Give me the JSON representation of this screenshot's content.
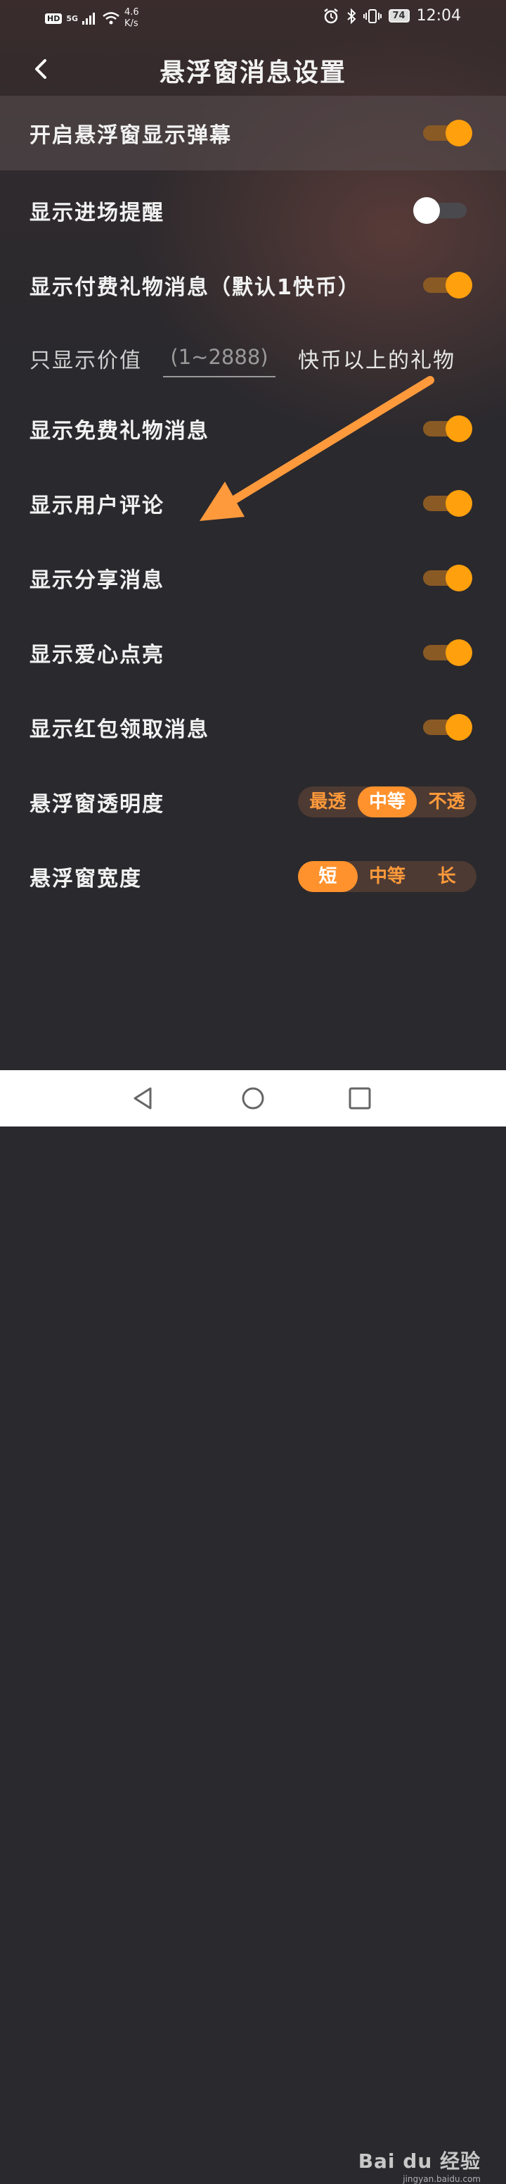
{
  "status_bar": {
    "hd": "HD",
    "network": "5G",
    "speed_value": "4.6",
    "speed_unit": "K/s",
    "battery": "74",
    "time": "12:04"
  },
  "header": {
    "title": "悬浮窗消息设置"
  },
  "settings": [
    {
      "label": "开启悬浮窗显示弹幕",
      "on": true
    },
    {
      "label": "显示进场提醒",
      "on": false
    },
    {
      "label": "显示付费礼物消息（默认1快币）",
      "on": true
    },
    {
      "label": "显示免费礼物消息",
      "on": true
    },
    {
      "label": "显示用户评论",
      "on": true
    },
    {
      "label": "显示分享消息",
      "on": true
    },
    {
      "label": "显示爱心点亮",
      "on": true
    },
    {
      "label": "显示红包领取消息",
      "on": true
    }
  ],
  "gift_threshold": {
    "prefix": "只显示价值",
    "placeholder": "(1~2888)",
    "suffix": "快币以上的礼物"
  },
  "opacity": {
    "label": "悬浮窗透明度",
    "options": [
      "最透",
      "中等",
      "不透"
    ],
    "selected": "中等"
  },
  "width": {
    "label": "悬浮窗宽度",
    "options": [
      "短",
      "中等",
      "长"
    ],
    "selected": "短"
  },
  "watermark": {
    "brand": "Bai du 经验",
    "url": "jingyan.baidu.com"
  },
  "colors": {
    "accent": "#ffa00c",
    "annotation_arrow": "#ff9a3c",
    "background": "#2a292d"
  }
}
